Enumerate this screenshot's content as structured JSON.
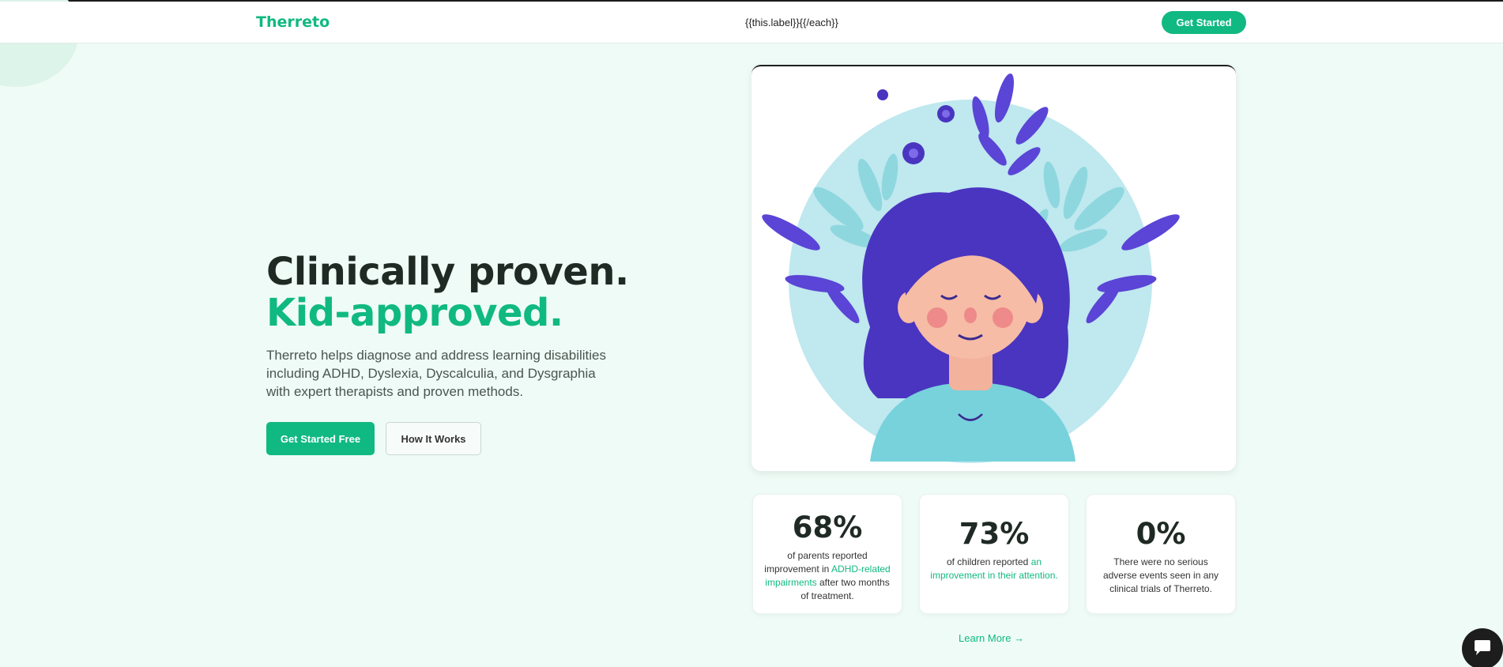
{
  "header": {
    "logo": "Therreto",
    "nav_template_text": "{{this.label}}{{/each}}",
    "cta_label": "Get Started"
  },
  "hero": {
    "title_line1": "Clinically proven.",
    "title_line2": "Kid-approved.",
    "description": "Therreto helps diagnose and address learning disabilities including ADHD, Dyslexia, Dyscalculia, and Dysgraphia with expert therapists and proven methods.",
    "primary_button": "Get Started Free",
    "secondary_button": "How It Works"
  },
  "stats": [
    {
      "value": "68%",
      "text_before": "of parents reported improvement in ",
      "highlight": "ADHD-related impairments",
      "text_after": " after two months of treatment."
    },
    {
      "value": "73%",
      "text_before": "of children reported ",
      "highlight": "an improvement in their attention.",
      "text_after": ""
    },
    {
      "value": "0%",
      "text_before": "There were no serious adverse events seen in any clinical trials of Therreto.",
      "highlight": "",
      "text_after": ""
    }
  ],
  "learn_more": "Learn More →",
  "colors": {
    "brand": "#10b981",
    "page_background": "#effbf6",
    "illustration_hair": "#4a35c0",
    "illustration_circle": "#bfe8ef"
  },
  "icons": {
    "chat": "chat-bubble-icon"
  }
}
